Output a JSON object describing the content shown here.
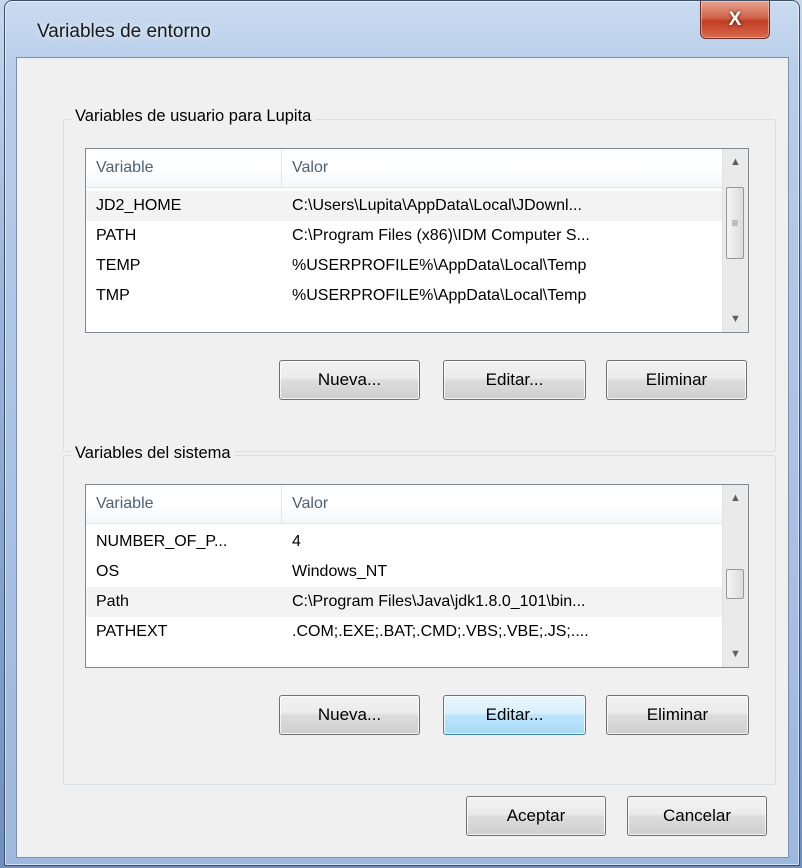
{
  "window": {
    "title": "Variables de entorno",
    "close_label": "X"
  },
  "user_group": {
    "label": "Variables de usuario para Lupita",
    "columns": [
      "Variable",
      "Valor"
    ],
    "rows": [
      {
        "variable": "JD2_HOME",
        "valor": "C:\\Users\\Lupita\\AppData\\Local\\JDownl..."
      },
      {
        "variable": "PATH",
        "valor": "C:\\Program Files (x86)\\IDM Computer S..."
      },
      {
        "variable": "TEMP",
        "valor": "%USERPROFILE%\\AppData\\Local\\Temp"
      },
      {
        "variable": "TMP",
        "valor": "%USERPROFILE%\\AppData\\Local\\Temp"
      }
    ],
    "buttons": {
      "new": "Nueva...",
      "edit": "Editar...",
      "delete": "Eliminar"
    }
  },
  "system_group": {
    "label": "Variables del sistema",
    "columns": [
      "Variable",
      "Valor"
    ],
    "rows": [
      {
        "variable": "NUMBER_OF_P...",
        "valor": "4"
      },
      {
        "variable": "OS",
        "valor": "Windows_NT"
      },
      {
        "variable": "Path",
        "valor": "C:\\Program Files\\Java\\jdk1.8.0_101\\bin..."
      },
      {
        "variable": "PATHEXT",
        "valor": ".COM;.EXE;.BAT;.CMD;.VBS;.VBE;.JS;...."
      }
    ],
    "buttons": {
      "new": "Nueva...",
      "edit": "Editar...",
      "delete": "Eliminar"
    }
  },
  "footer": {
    "ok": "Aceptar",
    "cancel": "Cancelar"
  },
  "icons": {
    "scroll_up": "triangle-up",
    "scroll_down": "triangle-down",
    "grip": "grip-lines"
  }
}
